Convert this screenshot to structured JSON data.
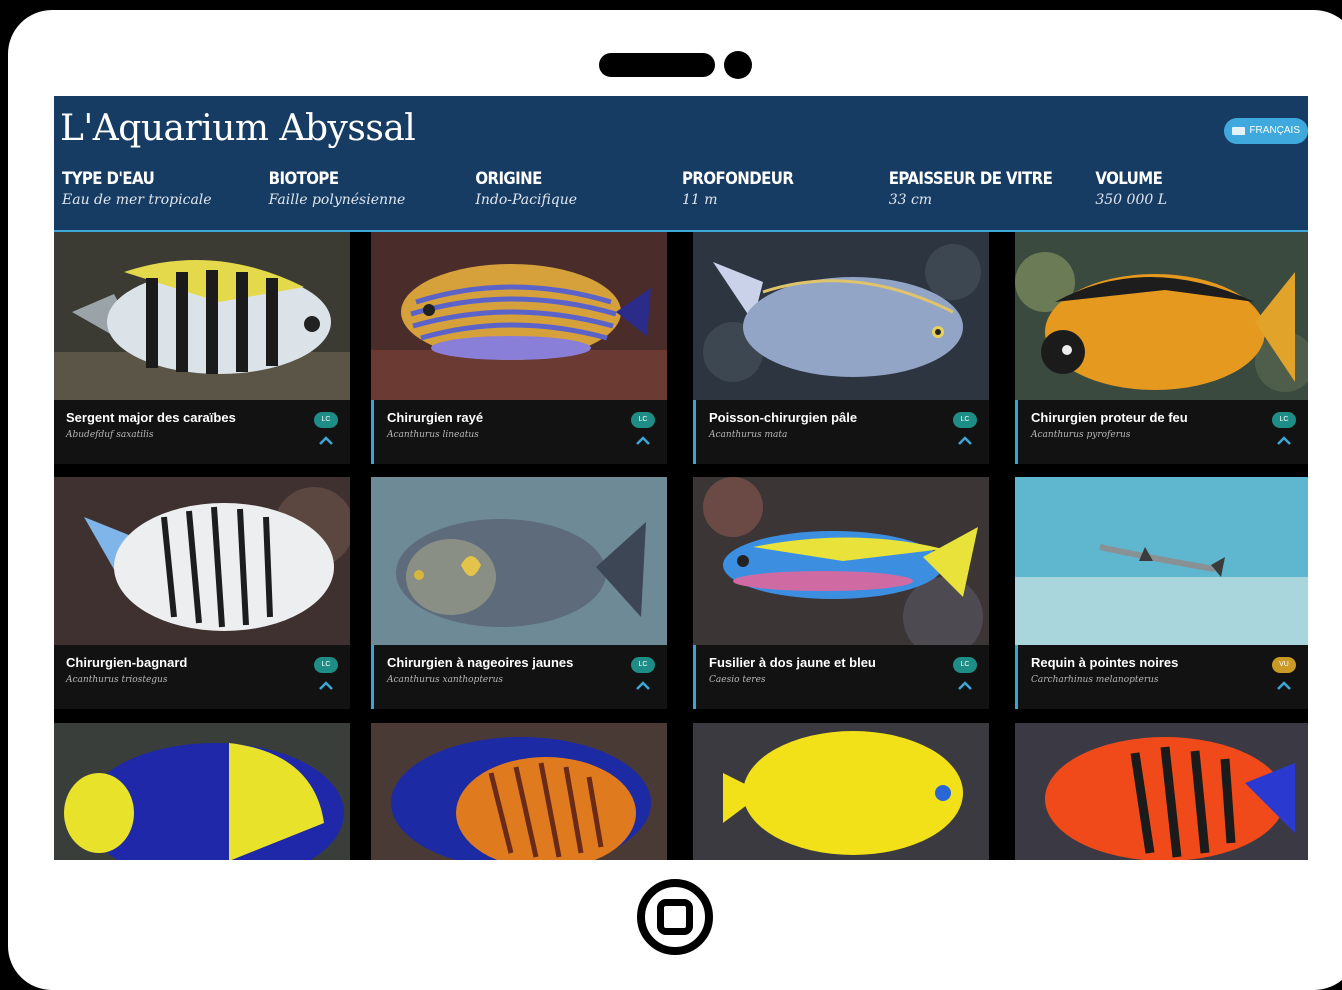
{
  "app": {
    "title": "L'Aquarium Abyssal",
    "language_label": "FRANÇAIS"
  },
  "specs": [
    {
      "label": "TYPE D'EAU",
      "value": "Eau de mer tropicale"
    },
    {
      "label": "BIOTOPE",
      "value": "Faille polynésienne"
    },
    {
      "label": "ORIGINE",
      "value": "Indo-Pacifique"
    },
    {
      "label": "PROFONDEUR",
      "value": "11 m"
    },
    {
      "label": "EPAISSEUR DE VITRE",
      "value": "33 cm"
    },
    {
      "label": "VOLUME",
      "value": "350 000 L"
    }
  ],
  "fish": [
    {
      "name": "Sergent major des caraïbes",
      "scientific": "Abudefduf saxatilis",
      "status": "LC"
    },
    {
      "name": "Chirurgien rayé",
      "scientific": "Acanthurus lineatus",
      "status": "LC"
    },
    {
      "name": "Poisson-chirurgien pâle",
      "scientific": "Acanthurus mata",
      "status": "LC"
    },
    {
      "name": "Chirurgien proteur de feu",
      "scientific": "Acanthurus pyroferus",
      "status": "LC"
    },
    {
      "name": "Chirurgien-bagnard",
      "scientific": "Acanthurus triostegus",
      "status": "LC"
    },
    {
      "name": "Chirurgien à nageoires jaunes",
      "scientific": "Acanthurus xanthopterus",
      "status": "LC"
    },
    {
      "name": "Fusilier à dos jaune et bleu",
      "scientific": "Caesio teres",
      "status": "LC"
    },
    {
      "name": "Requin à pointes noires",
      "scientific": "Carcharhinus melanopterus",
      "status": "VU"
    }
  ],
  "colors": {
    "header": "#173c63",
    "accent": "#3ea6d6",
    "lc_badge": "#1e8d86",
    "vu_badge": "#c99a26"
  }
}
